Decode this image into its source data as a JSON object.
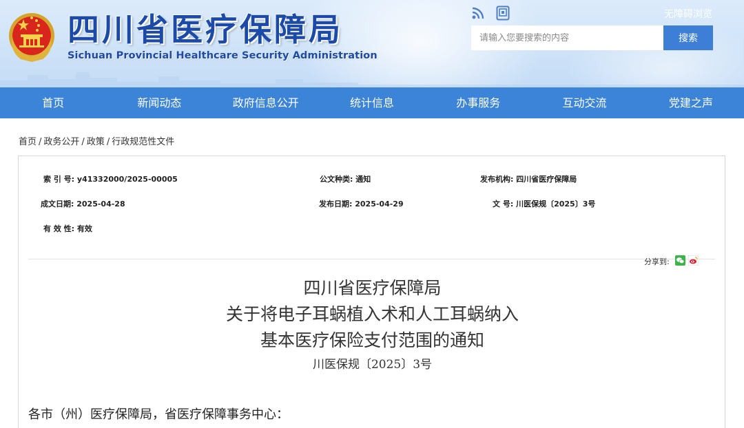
{
  "header": {
    "title_cn": "四川省医疗保障局",
    "title_en": "Sichuan Provincial Healthcare Security Administration",
    "accessibility_label": "无障碍浏览",
    "search_placeholder": "请输入您要搜索的内容",
    "search_button_label": "搜索",
    "icons": [
      "emblem-icon",
      "rss-icon",
      "mobile-icon"
    ]
  },
  "nav": {
    "items": [
      "首页",
      "新闻动态",
      "政府信息公开",
      "统计信息",
      "办事服务",
      "互动交流",
      "党建之声"
    ]
  },
  "breadcrumb": [
    "首页",
    "政务公开",
    "政策",
    "行政规范性文件"
  ],
  "meta": {
    "index_label": "索 引 号:",
    "index_value": "y41332000/2025-00005",
    "category_label": "公文种类:",
    "category_value": "通知",
    "issuer_label": "发布机构:",
    "issuer_value": "四川省医疗保障局",
    "created_label": "成文日期:",
    "created_value": "2025-04-28",
    "published_label": "发布日期:",
    "published_value": "2025-04-29",
    "docno_label": "文 号:",
    "docno_value": "川医保规〔2025〕3号",
    "validity_label": "有 效 性:",
    "validity_value": "有效"
  },
  "share": {
    "label": "分享到:",
    "icons": [
      "wechat-icon",
      "weibo-icon"
    ]
  },
  "document": {
    "title_lines": [
      "四川省医疗保障局",
      "关于将电子耳蜗植入术和人工耳蜗纳入",
      "基本医疗保险支付范围的通知"
    ],
    "doc_number": "川医保规〔2025〕3号",
    "salutation": "各市（州）医疗保障局，省医疗保障事务中心："
  },
  "colors": {
    "nav_bg": "#3c84d8",
    "logo_blue": "#1b4aa8",
    "search_button": "#3d7fd6",
    "header_bg": "#cfe3f8"
  }
}
